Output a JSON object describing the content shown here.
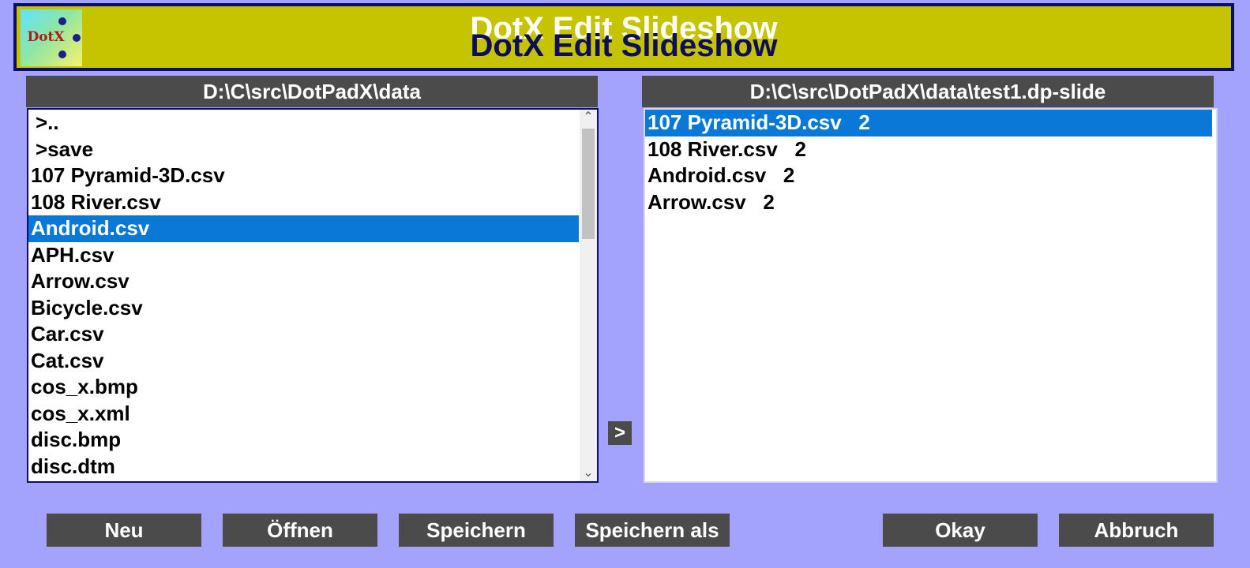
{
  "window": {
    "title": "DotX Edit Slideshow",
    "logo_text": "DotX"
  },
  "left_panel": {
    "path": "D:\\C\\src\\DotPadX\\data",
    "items": [
      ">..",
      ">save",
      "107 Pyramid-3D.csv",
      "108 River.csv",
      "Android.csv",
      "APH.csv",
      "Arrow.csv",
      "Bicycle.csv",
      "Car.csv",
      "Cat.csv",
      "cos_x.bmp",
      "cos_x.xml",
      "disc.bmp",
      "disc.dtm"
    ],
    "selected_index": 4
  },
  "right_panel": {
    "path": "D:\\C\\src\\DotPadX\\data\\test1.dp-slide",
    "items": [
      "107 Pyramid-3D.csv   2",
      "108 River.csv   2",
      "Android.csv   2",
      "Arrow.csv   2"
    ],
    "selected_index": 0
  },
  "move_button": {
    "label": ">"
  },
  "buttons": {
    "new": "Neu",
    "open": "Öffnen",
    "save": "Speichern",
    "save_as": "Speichern als",
    "okay": "Okay",
    "cancel": "Abbruch"
  },
  "colors": {
    "background": "#a3a3fd",
    "titlebar": "#c6c300",
    "header": "#4b4b4b",
    "selection": "#0a78d7",
    "border": "#0c0c6a"
  }
}
